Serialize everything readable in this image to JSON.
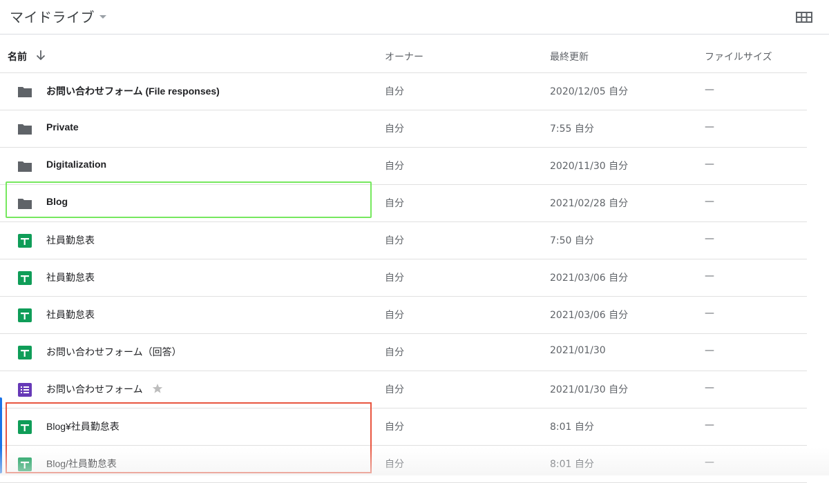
{
  "header": {
    "title": "マイドライブ"
  },
  "columns": {
    "name": "名前",
    "owner": "オーナー",
    "modified": "最終更新",
    "size": "ファイルサイズ"
  },
  "files": [
    {
      "name": "お問い合わせフォーム (File responses)",
      "type": "folder",
      "owner": "自分",
      "modified": "2020/12/05 自分",
      "size": "—"
    },
    {
      "name": "Private",
      "type": "folder",
      "owner": "自分",
      "modified": "7:55 自分",
      "size": "—"
    },
    {
      "name": "Digitalization",
      "type": "folder",
      "owner": "自分",
      "modified": "2020/11/30 自分",
      "size": "—"
    },
    {
      "name": "Blog",
      "type": "folder",
      "owner": "自分",
      "modified": "2021/02/28 自分",
      "size": "—"
    },
    {
      "name": "社員勤怠表",
      "type": "sheet",
      "owner": "自分",
      "modified": "7:50 自分",
      "size": "—"
    },
    {
      "name": "社員勤怠表",
      "type": "sheet",
      "owner": "自分",
      "modified": "2021/03/06 自分",
      "size": "—"
    },
    {
      "name": "社員勤怠表",
      "type": "sheet",
      "owner": "自分",
      "modified": "2021/03/06 自分",
      "size": "—"
    },
    {
      "name": "お問い合わせフォーム（回答）",
      "type": "sheet",
      "owner": "自分",
      "modified": "2021/01/30",
      "size": "—"
    },
    {
      "name": "お問い合わせフォーム",
      "type": "form",
      "owner": "自分",
      "modified": "2021/01/30 自分",
      "size": "—",
      "starred": true
    },
    {
      "name": "Blog¥社員勤怠表",
      "type": "sheet",
      "owner": "自分",
      "modified": "8:01 自分",
      "size": "—"
    },
    {
      "name": "Blog/社員勤怠表",
      "type": "sheet",
      "owner": "自分",
      "modified": "8:01 自分",
      "size": "—"
    }
  ],
  "colors": {
    "folder": "#5f6368",
    "sheet": "#0f9d58",
    "form": "#673ab7",
    "highlight_green": "#76e85e",
    "highlight_red": "#e8553f"
  }
}
